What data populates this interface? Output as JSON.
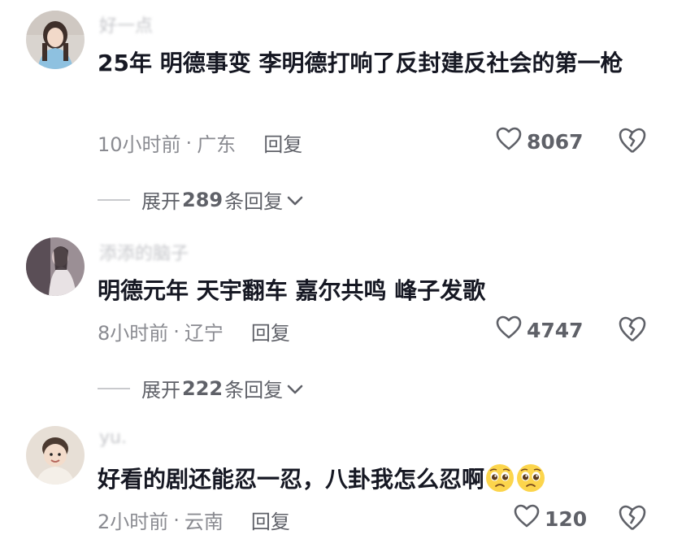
{
  "comments": [
    {
      "username": "好一点",
      "text": "25年 明德事变 李明德打响了反封建反社会的第一枪",
      "time": "10小时前",
      "location": "广东",
      "reply_label": "回复",
      "likes": "8067",
      "expand_prefix": "展开",
      "expand_count": "289",
      "expand_suffix": "条回复"
    },
    {
      "username": "添添的脑子",
      "text": "明德元年 天宇翻车 嘉尔共鸣 峰子发歌",
      "time": "8小时前",
      "location": "辽宁",
      "reply_label": "回复",
      "likes": "4747",
      "expand_prefix": "展开",
      "expand_count": "222",
      "expand_suffix": "条回复"
    },
    {
      "username": "yu.",
      "text": "好看的剧还能忍一忍，八卦我怎么忍啊",
      "time": "2小时前",
      "location": "云南",
      "reply_label": "回复",
      "likes": "120"
    }
  ],
  "icons": {
    "like": "heart-outline-icon",
    "dislike": "broken-heart-icon",
    "expand": "chevron-down-icon",
    "emoji": "pleading-face-emoji"
  },
  "colors": {
    "text": "#161823",
    "meta": "#8a8b91",
    "action": "#5f6168"
  }
}
